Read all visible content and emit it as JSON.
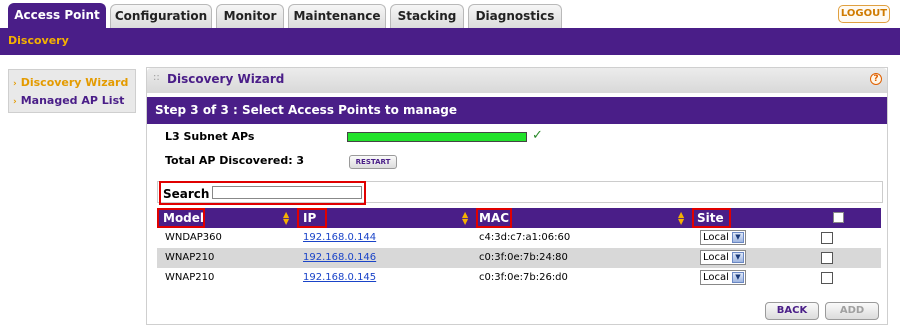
{
  "tabs": [
    {
      "label": "Access Point",
      "active": true
    },
    {
      "label": "Configuration",
      "active": false
    },
    {
      "label": "Monitor",
      "active": false
    },
    {
      "label": "Maintenance",
      "active": false
    },
    {
      "label": "Stacking",
      "active": false
    },
    {
      "label": "Diagnostics",
      "active": false
    }
  ],
  "logout_label": "LOGOUT",
  "subnav": {
    "label": "Discovery"
  },
  "sidebar": {
    "items": [
      {
        "label": "Discovery Wizard",
        "active": true
      },
      {
        "label": "Managed AP List",
        "active": false
      }
    ]
  },
  "panel": {
    "title": "Discovery Wizard",
    "help_icon": "?",
    "step_title": "Step 3 of 3 : Select Access Points to manage",
    "subnet_label": "L3 Subnet APs",
    "progress_percent": 100,
    "check_glyph": "✓",
    "total_label": "Total AP Discovered: 3",
    "restart_label": "RESTART",
    "search_label": "Search",
    "search_value": ""
  },
  "table": {
    "columns": [
      "Model",
      "IP",
      "MAC",
      "Site"
    ],
    "rows": [
      {
        "model": "WNDAP360",
        "ip": "192.168.0.144",
        "mac": "c4:3d:c7:a1:06:60",
        "site": "Local"
      },
      {
        "model": "WNAP210",
        "ip": "192.168.0.146",
        "mac": "c0:3f:0e:7b:24:80",
        "site": "Local"
      },
      {
        "model": "WNAP210",
        "ip": "192.168.0.145",
        "mac": "c0:3f:0e:7b:26:d0",
        "site": "Local"
      }
    ]
  },
  "buttons": {
    "back": "BACK",
    "add": "ADD"
  },
  "colors": {
    "brand_purple": "#4a1e88",
    "accent_orange": "#e49b00",
    "progress_green": "#22e22b",
    "highlight_red": "#e00000"
  }
}
